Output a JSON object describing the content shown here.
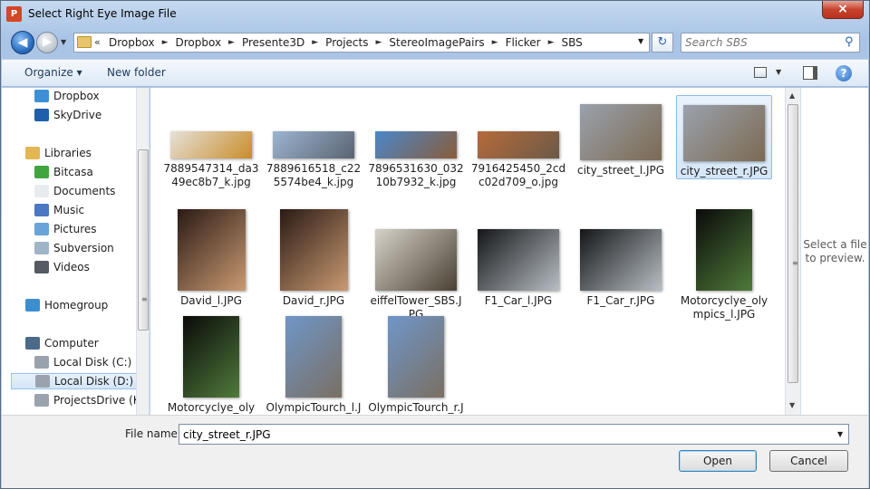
{
  "window": {
    "title": "Select Right Eye Image File",
    "app_icon": "P",
    "close_label": "×"
  },
  "nav": {
    "back_glyph": "◀",
    "forward_glyph": "▶",
    "history_glyph": "▼",
    "address": {
      "overflow": "«",
      "crumbs": [
        "Dropbox",
        "Dropbox",
        "Presente3D",
        "Projects",
        "StereoImagePairs",
        "Flicker",
        "SBS"
      ],
      "separator": "►",
      "dropdown_glyph": "▼"
    },
    "refresh_glyph": "↻",
    "search": {
      "placeholder": "Search SBS",
      "icon_glyph": "⚲"
    }
  },
  "toolbar": {
    "organize_label": "Organize ▾",
    "new_folder_label": "New folder",
    "view_drop_glyph": "▼",
    "help_glyph": "?"
  },
  "navpane": {
    "items": [
      {
        "label": "Dropbox",
        "icon": "dropbox-icon",
        "color": "#3d8fd6"
      },
      {
        "label": "SkyDrive",
        "icon": "skydrive-icon",
        "color": "#1f5faa"
      },
      {
        "label": "Libraries",
        "icon": "libraries-icon",
        "color": "#e2b752"
      },
      {
        "label": "Bitcasa",
        "icon": "bitcasa-icon",
        "color": "#3fa63f"
      },
      {
        "label": "Documents",
        "icon": "documents-icon",
        "color": "#e9ecef"
      },
      {
        "label": "Music",
        "icon": "music-icon",
        "color": "#4a78c2"
      },
      {
        "label": "Pictures",
        "icon": "pictures-icon",
        "color": "#6aa3d8"
      },
      {
        "label": "Subversion",
        "icon": "subversion-icon",
        "color": "#a0b4c8"
      },
      {
        "label": "Videos",
        "icon": "videos-icon",
        "color": "#555a63"
      },
      {
        "label": "Homegroup",
        "icon": "homegroup-icon",
        "color": "#3b8fcf"
      },
      {
        "label": "Computer",
        "icon": "computer-icon",
        "color": "#4b6a8a"
      },
      {
        "label": "Local Disk (C:)",
        "icon": "disk-c-icon",
        "color": "#9aa3ad"
      },
      {
        "label": "Local Disk (D:)",
        "icon": "disk-d-icon",
        "color": "#9aa3ad"
      },
      {
        "label": "ProjectsDrive (K:)",
        "icon": "disk-k-icon",
        "color": "#9aa3ad"
      }
    ],
    "grip_glyph": "≡"
  },
  "files": [
    {
      "name": "7889547314_da349ec8b7_k.jpg",
      "thumb_colors": [
        "#e6e1d9",
        "#c98d2a"
      ]
    },
    {
      "name": "7889616518_c225574be4_k.jpg",
      "thumb_colors": [
        "#9cb5d1",
        "#5a6371"
      ]
    },
    {
      "name": "7896531630_03210b7932_k.jpg",
      "thumb_colors": [
        "#4a87c9",
        "#8a5c3a"
      ]
    },
    {
      "name": "7916425450_2cdc02d709_o.jpg",
      "thumb_colors": [
        "#b66a3a",
        "#6b5a48"
      ]
    },
    {
      "name": "city_street_l.JPG",
      "thumb_colors": [
        "#9aa2ad",
        "#7c6a52"
      ]
    },
    {
      "name": "city_street_r.JPG",
      "thumb_colors": [
        "#9aa2ad",
        "#7c6a52"
      ]
    },
    {
      "name": "David_l.JPG",
      "thumb_colors": [
        "#2a1a14",
        "#c99a72"
      ]
    },
    {
      "name": "David_r.JPG",
      "thumb_colors": [
        "#2a1a14",
        "#c99a72"
      ]
    },
    {
      "name": "eiffelTower_SBS.JPG",
      "thumb_colors": [
        "#d6d2c8",
        "#4a4034"
      ]
    },
    {
      "name": "F1_Car_l.JPG",
      "thumb_colors": [
        "#141618",
        "#b8bec4"
      ]
    },
    {
      "name": "F1_Car_r.JPG",
      "thumb_colors": [
        "#141618",
        "#b8bec4"
      ]
    },
    {
      "name": "Motorcyclye_olympics_l.JPG",
      "thumb_colors": [
        "#0a0a0a",
        "#4f7a3a"
      ]
    },
    {
      "name": "Motorcyclye_olympics_r.JPG",
      "thumb_colors": [
        "#0a0a0a",
        "#4f7a3a"
      ]
    },
    {
      "name": "OlympicTourch_l.JPG",
      "thumb_colors": [
        "#6f96c8",
        "#7a6f62"
      ]
    },
    {
      "name": "OlympicTourch_r.JPG",
      "thumb_colors": [
        "#6f96c8",
        "#7a6f62"
      ]
    }
  ],
  "scrollbar": {
    "up_glyph": "▲",
    "down_glyph": "▼",
    "grip_glyph": "≡"
  },
  "preview": {
    "text": "Select a file to preview."
  },
  "bottom": {
    "file_name_label": "File name:",
    "file_name_value": "city_street_r.JPG",
    "dropdown_glyph": "▼",
    "open_label": "Open",
    "cancel_label": "Cancel"
  }
}
